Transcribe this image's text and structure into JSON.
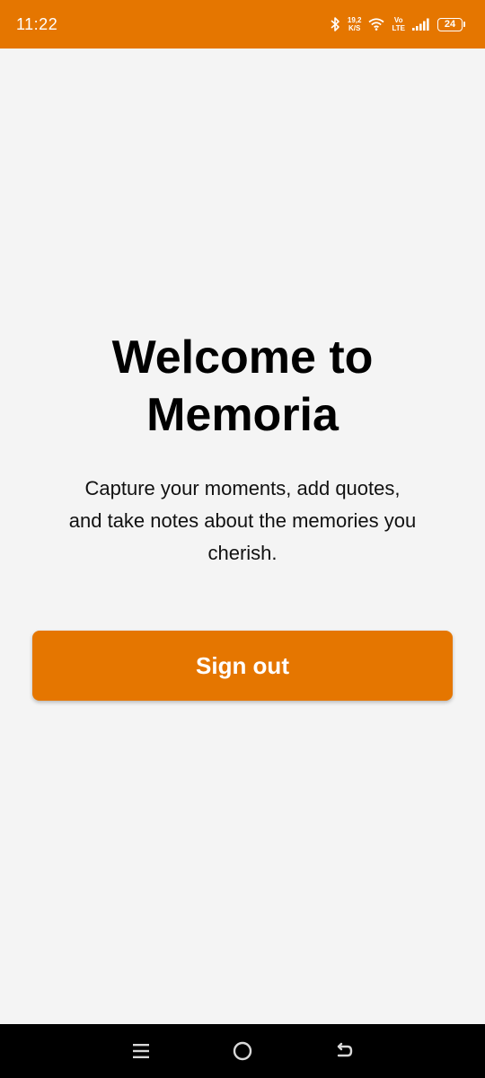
{
  "status_bar": {
    "time": "11:22",
    "network_speed_value": "19,2",
    "network_speed_unit": "K/S",
    "volte_top": "Vo",
    "volte_bottom": "LTE",
    "battery_level": "24",
    "background_color": "#e57600"
  },
  "main": {
    "title_line1": "Welcome to",
    "title_line2": "Memoria",
    "subtitle_line1": "Capture your moments, add quotes,",
    "subtitle_line2": "and take notes about the memories you",
    "subtitle_line3": "cherish.",
    "signout_label": "Sign out",
    "accent_color": "#e57600"
  },
  "nav_bar": {
    "icons": [
      "menu-icon",
      "home-icon",
      "back-icon"
    ]
  }
}
